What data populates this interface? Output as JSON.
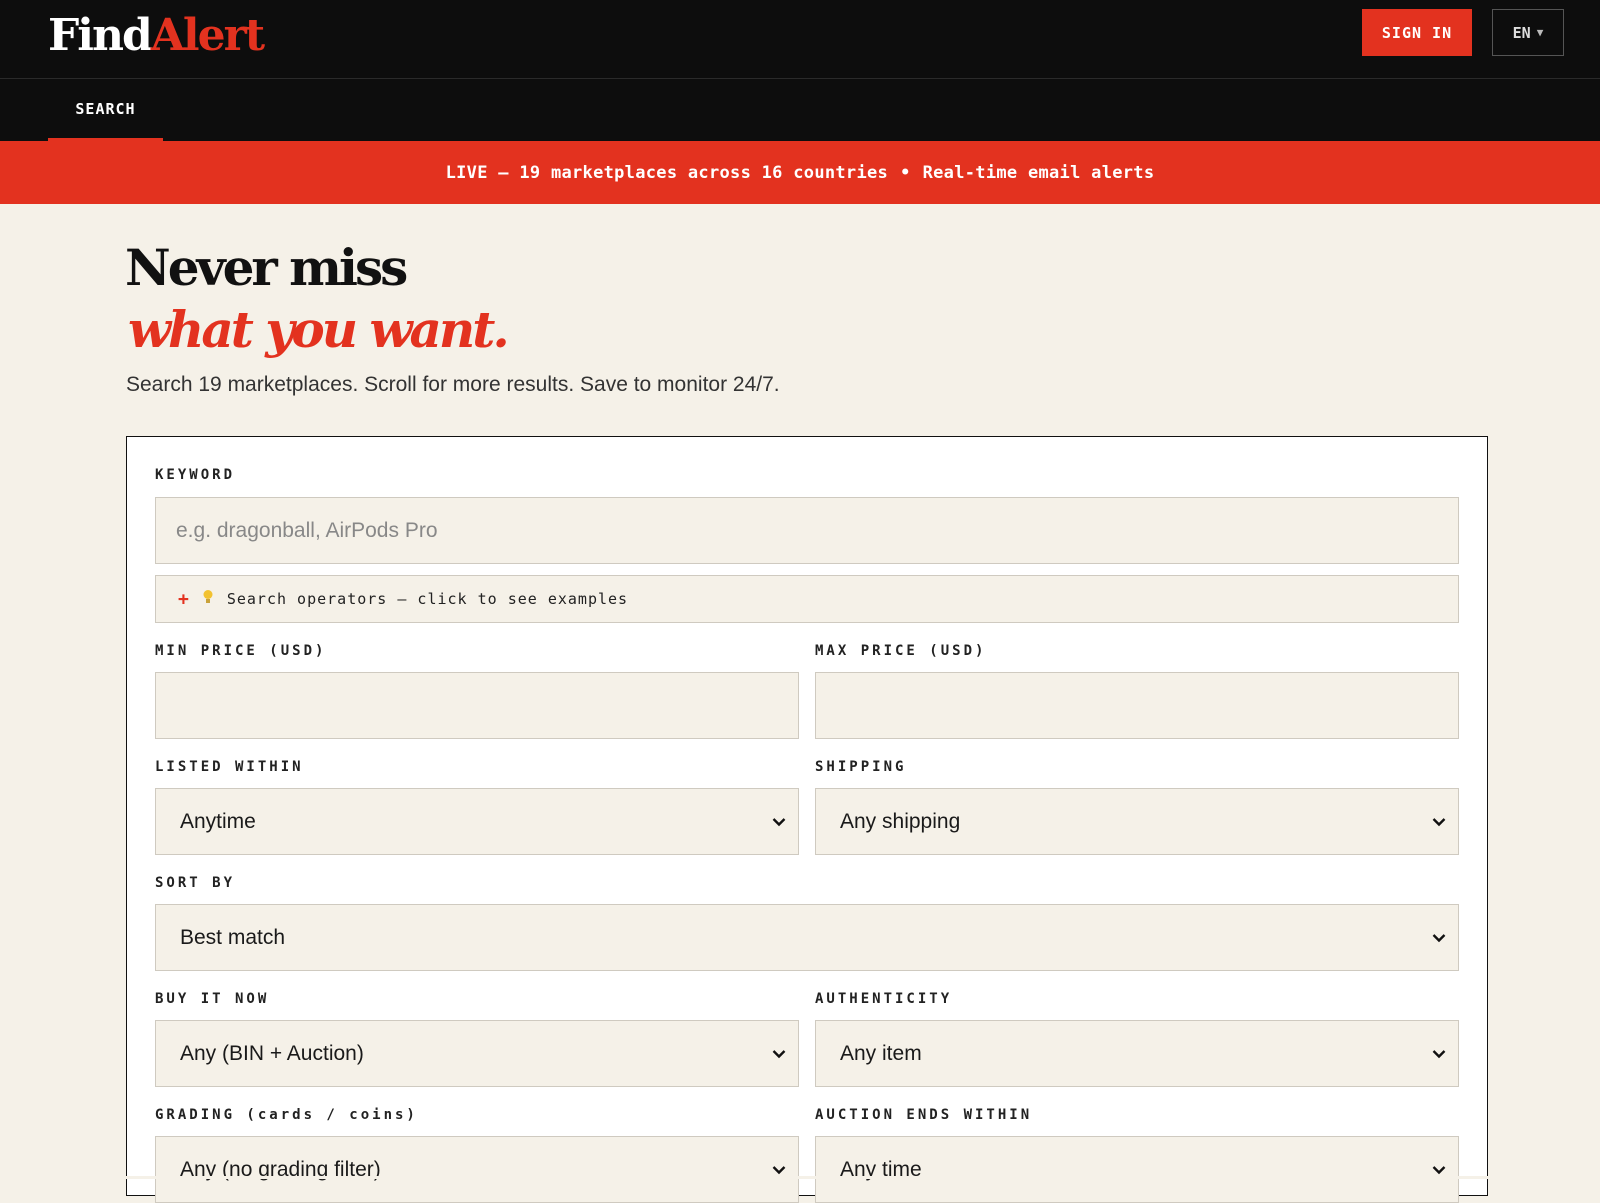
{
  "header": {
    "logo_part1": "Find",
    "logo_part2": "Alert",
    "signin_label": "SIGN IN",
    "language": "EN",
    "language_caret": "▼"
  },
  "nav": {
    "tabs": [
      {
        "label": "SEARCH",
        "active": true
      }
    ]
  },
  "banner": {
    "part1": "LIVE — 19 marketplaces across 16 countries",
    "separator": "•",
    "part2": "Real-time email alerts"
  },
  "hero": {
    "line1": "Never miss",
    "line2": "what you want.",
    "subtitle": "Search 19 marketplaces. Scroll for more results. Save to monitor 24/7."
  },
  "form": {
    "keyword_label": "KEYWORD",
    "keyword_placeholder": "e.g. dragonball, AirPods Pro",
    "keyword_value": "",
    "operators_plus": "+",
    "operators_icon": "lightbulb-icon",
    "operators_text": "Search operators — click to see examples",
    "min_price_label": "MIN PRICE (USD)",
    "max_price_label": "MAX PRICE (USD)",
    "min_price_value": "",
    "max_price_value": "",
    "listed_within_label": "LISTED WITHIN",
    "listed_within_value": "Anytime",
    "shipping_label": "SHIPPING",
    "shipping_value": "Any shipping",
    "sort_by_label": "SORT BY",
    "sort_by_value": "Best match",
    "buy_it_now_label": "BUY IT NOW",
    "buy_it_now_value": "Any (BIN + Auction)",
    "authenticity_label": "AUTHENTICITY",
    "authenticity_value": "Any item",
    "grading_label": "GRADING (cards / coins)",
    "grading_value": "Any (no grading filter)",
    "auction_ends_label": "AUCTION ENDS WITHIN",
    "auction_ends_value": "Any time"
  },
  "colors": {
    "accent": "#e3321f",
    "dark": "#0d0d0d",
    "background": "#f5f1e8"
  }
}
